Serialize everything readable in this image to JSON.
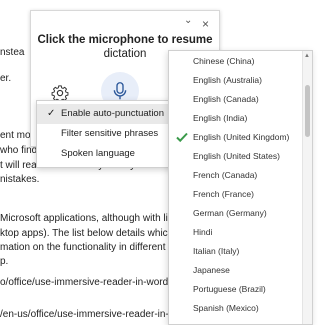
{
  "document": {
    "lines": [
      "nstea",
      "er.",
      "ent more",
      "who find c",
      "t will read aloud exactly what you have t",
      "nistakes.",
      " Microsoft applications, although with lin",
      "ktop apps). The list below details which ap",
      "mation on the functionality in different fo",
      "p.",
      "o/office/use-immersive-reader-in-word-a",
      "/en-us/office/use-immersive-reader-in-p"
    ]
  },
  "dictation": {
    "title": "Click the microphone to resume",
    "subtitle": "dictation",
    "collapse_glyph": "⌄",
    "close_glyph": "×"
  },
  "settings_menu": {
    "items": [
      {
        "label": "Enable auto-punctuation",
        "checked": true
      },
      {
        "label": "Filter sensitive phrases",
        "checked": false
      },
      {
        "label": "Spoken language",
        "submenu": true
      }
    ],
    "submenu_glyph": "›",
    "check_glyph": "✓"
  },
  "languages": {
    "selected": "English (United Kingdom)",
    "items": [
      "Chinese (China)",
      "English (Australia)",
      "English (Canada)",
      "English (India)",
      "English (United Kingdom)",
      "English (United States)",
      "French (Canada)",
      "French (France)",
      "German (Germany)",
      "Hindi",
      "Italian (Italy)",
      "Japanese",
      "Portuguese (Brazil)",
      "Spanish (Mexico)"
    ]
  },
  "colors": {
    "accent": "#2b579a",
    "check_green": "#3a9a4a",
    "mic_bg": "#e8eef9"
  }
}
